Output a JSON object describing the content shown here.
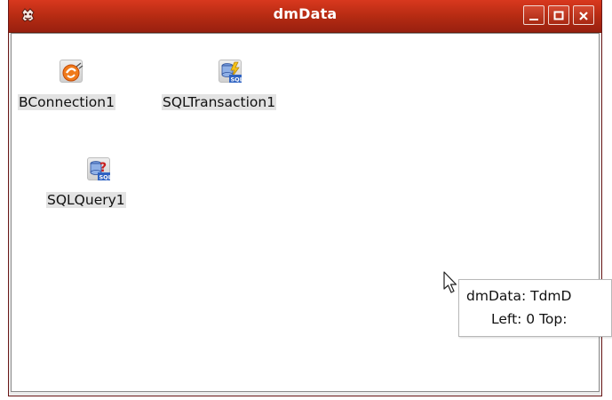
{
  "window": {
    "title": "dmData",
    "menu_icon": "app-menu-icon",
    "controls": [
      "minimize-icon",
      "maximize-icon",
      "close-icon"
    ],
    "accent_color": "#b32a12"
  },
  "components": [
    {
      "label": "BConnection1",
      "icon": "database-connection-icon"
    },
    {
      "label": "SQLTransaction1",
      "icon": "sql-transaction-icon"
    },
    {
      "label": "SQLQuery1",
      "icon": "sql-query-icon"
    }
  ],
  "tooltip": {
    "line1": "dmData: TdmD",
    "line2": "Left: 0  Top:"
  }
}
